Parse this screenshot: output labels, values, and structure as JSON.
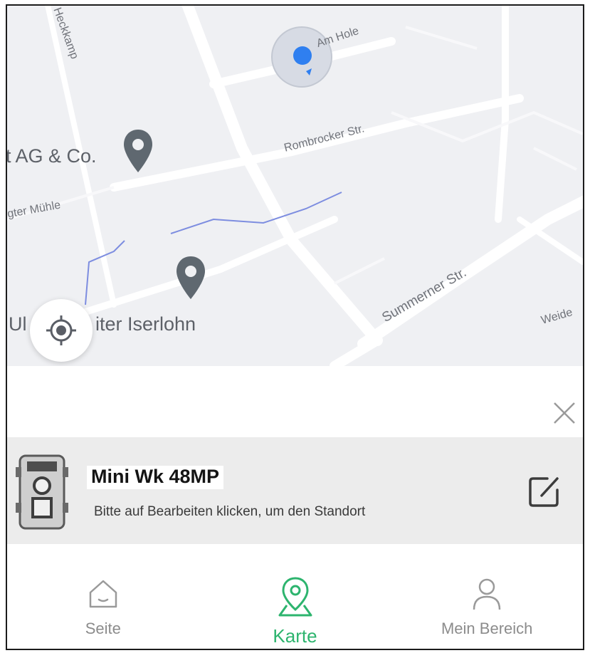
{
  "map": {
    "labels": {
      "poi_top": "t AG & Co.",
      "poi_bottom_prefix": "Ul",
      "poi_bottom": "iter Iserlohn",
      "street_rombrocker": "Rombrocker Str.",
      "street_summerner": "Summerner Str.",
      "street_muhle": "gter Mühle",
      "street_hole": "Am Hole",
      "street_kamp": "Heckkamp",
      "street_weide": "Weide"
    }
  },
  "device": {
    "name": "Mini Wk 48MP",
    "hint": "Bitte auf Bearbeiten klicken, um den Standort"
  },
  "tabs": [
    {
      "label": "Seite",
      "icon": "home-icon",
      "active": false
    },
    {
      "label": "Karte",
      "icon": "map-pin-icon",
      "active": true
    },
    {
      "label": "Mein Bereich",
      "icon": "user-icon",
      "active": false
    }
  ],
  "colors": {
    "accent": "#2db46e",
    "user_location": "#2f7ff0",
    "pin": "#5f6870",
    "map_background": "#eff0f3"
  }
}
